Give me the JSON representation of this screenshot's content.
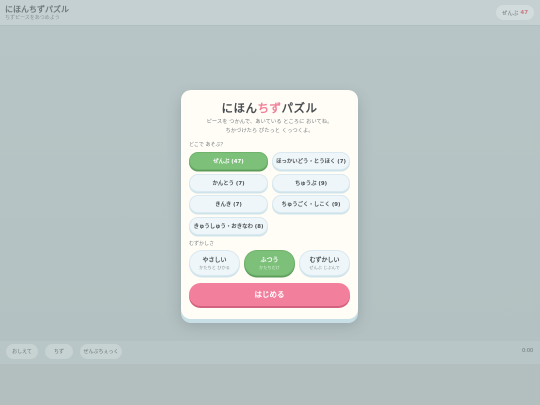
{
  "background": {
    "title": "にほんちずパズル",
    "subtitle": "ちずピースをあつめよう",
    "region_button": {
      "label": "ぜんぶ",
      "count": "47"
    },
    "footer": {
      "buttons": [
        "おしえて",
        "ちず",
        "ぜんぶちぇっく"
      ],
      "timer": "0:00"
    }
  },
  "modal": {
    "title_part1": "にほん",
    "title_accent": "ちず",
    "title_part2": "パズル",
    "desc_line1": "ピースを つかんで、あいている ところに おいてね。",
    "desc_line2": "ちかづけたら ぴたっと くっつくよ。",
    "region_label": "どこで あそぶ？",
    "regions": [
      {
        "label": "ぜんぶ (47)",
        "selected": true
      },
      {
        "label": "ほっかいどう・とうほく (7)",
        "selected": false
      },
      {
        "label": "かんとう (7)",
        "selected": false
      },
      {
        "label": "ちゅうぶ (9)",
        "selected": false
      },
      {
        "label": "きんき (7)",
        "selected": false
      },
      {
        "label": "ちゅうごく・しこく (9)",
        "selected": false
      },
      {
        "label": "きゅうしゅう・おきなわ (8)",
        "selected": false
      }
    ],
    "difficulty_label": "むずかしさ",
    "difficulties": [
      {
        "name": "やさしい",
        "sub": "かたちと ひかる",
        "selected": false
      },
      {
        "name": "ふつう",
        "sub": "かたちだけ",
        "selected": true
      },
      {
        "name": "むずかしい",
        "sub": "ぜんぶ じぶんで",
        "selected": false
      }
    ],
    "start_label": "はじめる"
  },
  "colors": {
    "accent_pink": "#f2809d",
    "selected_green": "#7cc07a",
    "button_blue": "#eef6fa"
  }
}
